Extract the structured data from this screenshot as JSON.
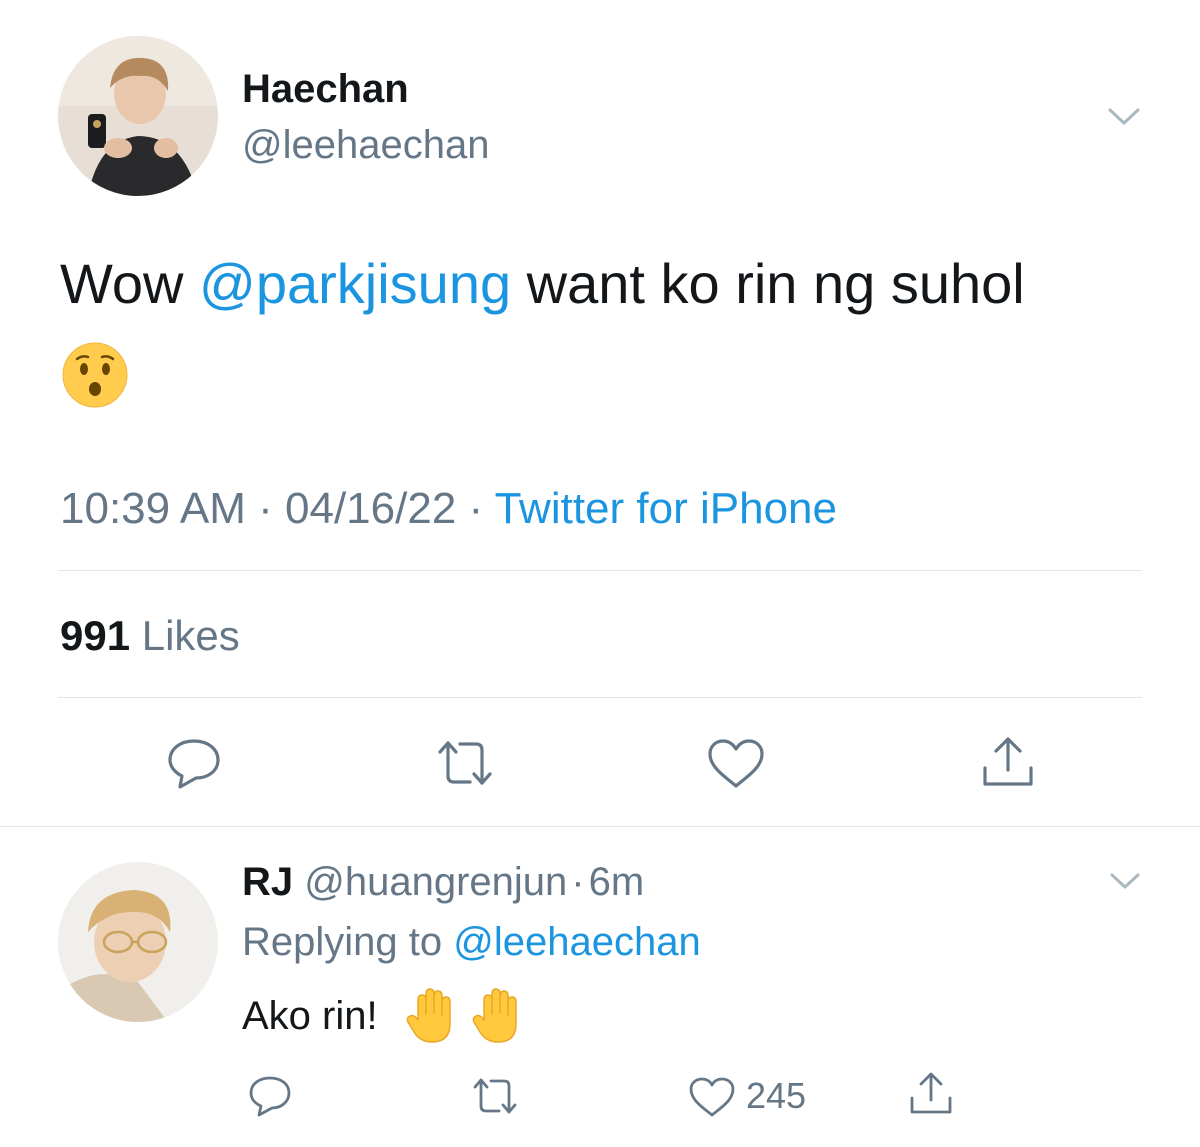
{
  "tweet": {
    "author_name": "Haechan",
    "author_handle": "@leehaechan",
    "text_prefix": "Wow ",
    "mention": "@parkjisung",
    "text_suffix": " want ko rin ng suhol",
    "emoji": "😯",
    "time": "10:39 AM",
    "sep1": " · ",
    "date": "04/16/22",
    "sep2": " · ",
    "source": "Twitter for iPhone",
    "likes_count": "991",
    "likes_label": " Likes"
  },
  "reply": {
    "author_name": "RJ",
    "author_handle": "@huangrenjun",
    "dot": "·",
    "time": "6m",
    "replying_to_label": "Replying to ",
    "replying_to_handle": "@leehaechan",
    "text": "Ako rin!",
    "emoji_1": "🖐",
    "emoji_2": "🖐",
    "like_count": "245"
  },
  "icons": {
    "main_caret": "chevron-down-icon",
    "reply_caret": "chevron-down-icon",
    "reply": "comment-icon",
    "retweet": "retweet-icon",
    "like": "heart-icon",
    "share": "share-icon"
  },
  "colors": {
    "link": "#1b95e0",
    "secondary_text": "#657786",
    "divider": "#e1e8ed",
    "emoji_face": "#ffcc4d",
    "emoji_hand": "#ffc83d"
  }
}
